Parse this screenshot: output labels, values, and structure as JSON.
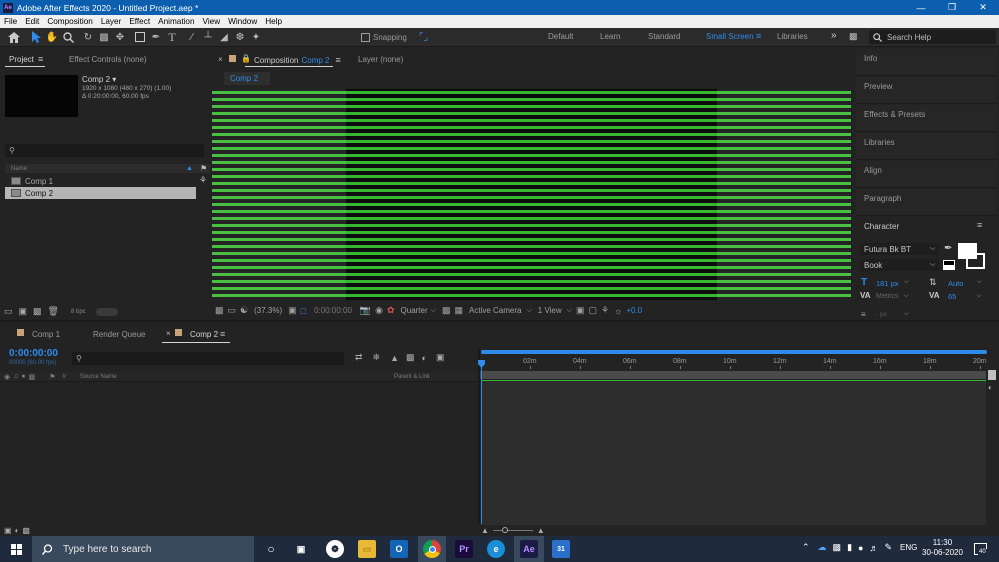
{
  "window": {
    "title": "Adobe After Effects 2020 - Untitled Project.aep *",
    "app_icon": "Ae"
  },
  "menu": [
    "File",
    "Edit",
    "Composition",
    "Layer",
    "Effect",
    "Animation",
    "View",
    "Window",
    "Help"
  ],
  "toolbar": {
    "snapping_label": "Snapping",
    "workspaces": [
      "Default",
      "Learn",
      "Standard",
      "Small Screen",
      "Libraries"
    ],
    "active_workspace": "Small Screen",
    "search_placeholder": "Search Help"
  },
  "project_panel": {
    "tab_project": "Project",
    "tab_effect_controls": "Effect Controls (none)",
    "comp_name": "Comp 2 ▾",
    "comp_size": "1920 x 1080  (480 x 270) (1.00)",
    "comp_duration": "Δ 0:20:00:00, 60.00 fps",
    "column_name": "Name",
    "items": [
      "Comp 1",
      "Comp 2"
    ],
    "selected_index": 1,
    "bpc": "8 bpc"
  },
  "viewer": {
    "tab_composition_prefix": "Composition",
    "tab_composition_name": "Comp 2",
    "tab_layer": "Layer  (none)",
    "breadcrumb": "Comp 2",
    "zoom": "(37.3%)",
    "timecode": "0:00:00:00",
    "resolution": "Quarter",
    "camera": "Active Camera",
    "views": "1 View",
    "exposure": "+0.0"
  },
  "right_panel": {
    "items": [
      "Info",
      "Preview",
      "Effects & Presets",
      "Libraries",
      "Align",
      "Paragraph",
      "Character"
    ],
    "character": {
      "font": "Futura Bk BT",
      "style": "Book",
      "size": "181 px",
      "leading": "Auto",
      "kerning": "Metrics",
      "tracking": "65",
      "extra": "- px"
    }
  },
  "timeline": {
    "tabs": [
      "Comp 1",
      "Render Queue",
      "Comp 2"
    ],
    "active_tab": "Comp 2",
    "timecode": "0:00:00:00",
    "frame_info": "00000 (60.00 fps)",
    "col_index": "#",
    "col_source": "Source Name",
    "col_parent": "Parent & Link",
    "ruler_labels": [
      "0s",
      "02m",
      "04m",
      "06m",
      "08m",
      "10m",
      "12m",
      "14m",
      "16m",
      "18m",
      "20m"
    ]
  },
  "taskbar": {
    "search_placeholder": "Type here to search",
    "language": "ENG",
    "time": "11:30",
    "date": "30-06-2020",
    "notification_count": "40",
    "pinned": [
      "task-view",
      "mail-app",
      "file-explorer",
      "outlook",
      "chrome",
      "premiere-pro",
      "edge",
      "after-effects",
      "calendar"
    ]
  },
  "colors": {
    "accent_blue": "#2d8ceb",
    "titlebar_blue": "#0c5faf",
    "stripe_green": "#35b82f",
    "panel_bg": "#232323"
  }
}
